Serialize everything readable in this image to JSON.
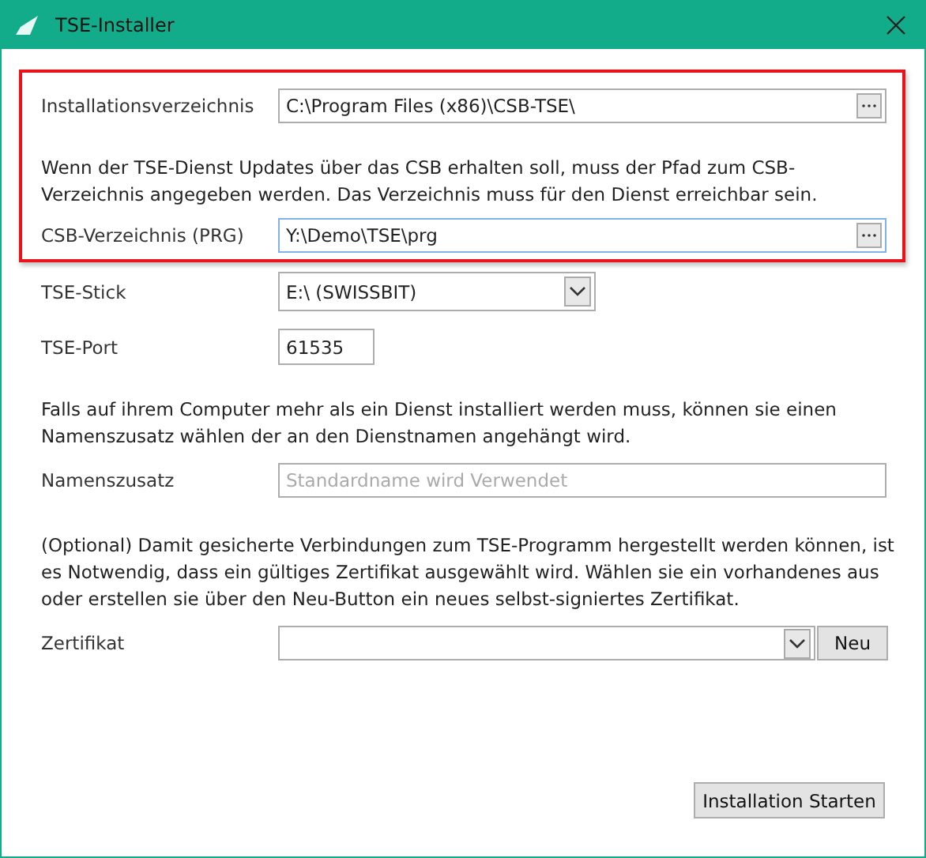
{
  "window": {
    "title": "TSE-Installer"
  },
  "highlighted_group": {
    "install_dir": {
      "label": "Installationsverzeichnis",
      "value": "C:\\Program Files (x86)\\CSB-TSE\\",
      "focused": false
    },
    "hint": "Wenn der TSE-Dienst Updates über das CSB erhalten soll, muss der Pfad zum CSB-Verzeichnis angegeben werden. Das Verzeichnis muss für den Dienst erreichbar sein.",
    "csb_dir": {
      "label": "CSB-Verzeichnis (PRG)",
      "value": "Y:\\Demo\\TSE\\prg",
      "focused": true
    }
  },
  "tse_stick": {
    "label": "TSE-Stick",
    "value": "E:\\ (SWISSBIT)"
  },
  "tse_port": {
    "label": "TSE-Port",
    "value": "61535"
  },
  "name_hint": "Falls auf ihrem Computer mehr als ein Dienst installiert werden muss, können sie einen Namenszusatz wählen der an den Dienstnamen angehängt wird.",
  "name_suffix": {
    "label": "Namenszusatz",
    "placeholder": "Standardname wird Verwendet"
  },
  "cert_hint": "(Optional) Damit gesicherte Verbindungen zum TSE-Programm hergestellt werden können, ist es Notwendig, dass ein gültiges Zertifikat ausgewählt wird. Wählen sie ein vorhandenes aus oder erstellen sie über den Neu-Button ein neues selbst-signiertes Zertifikat.",
  "certificate": {
    "label": "Zertifikat",
    "new_button": "Neu"
  },
  "buttons": [
    "Installation Starten"
  ]
}
